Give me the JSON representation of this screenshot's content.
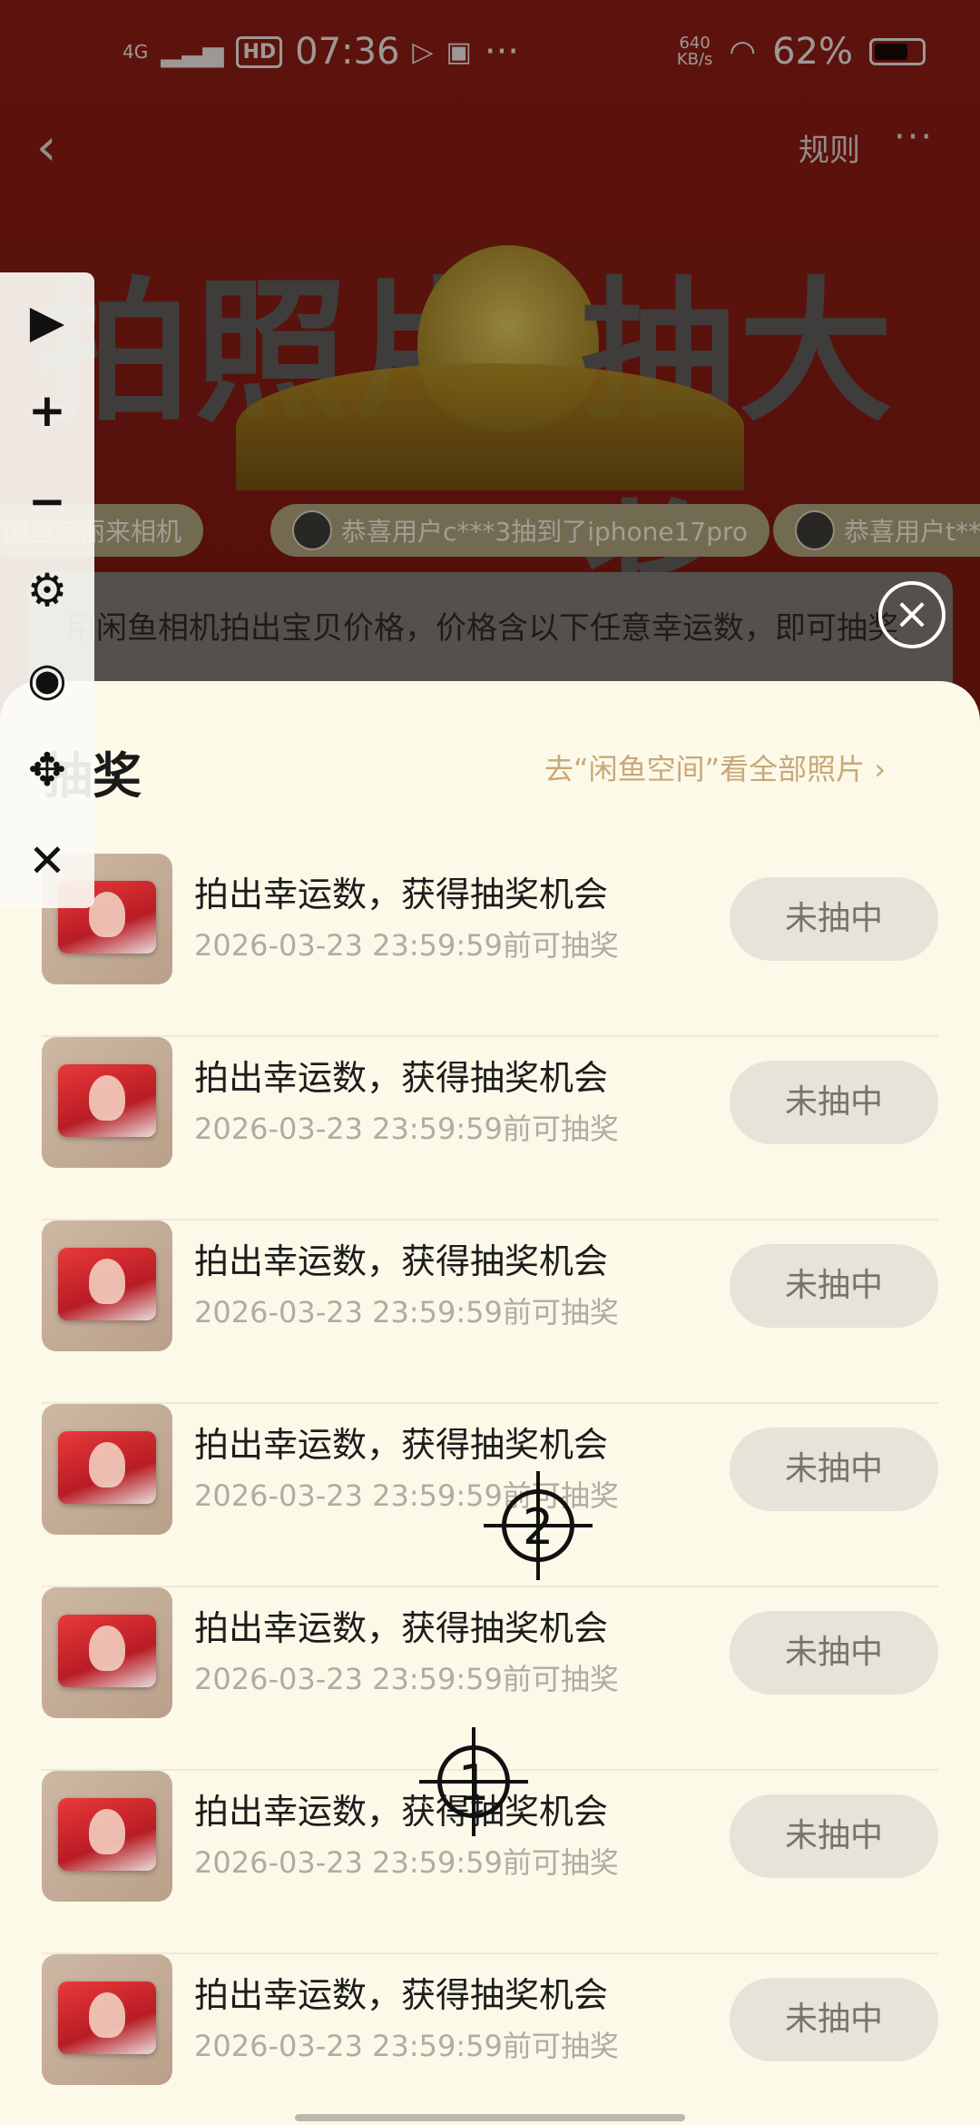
{
  "status": {
    "network": "4G",
    "hd": "HD",
    "time": "07:36",
    "more": "···",
    "speed_value": "640",
    "speed_unit": "KB/s",
    "battery": "62%"
  },
  "nav": {
    "back": "‹",
    "rules": "规则",
    "more": "···"
  },
  "hero": {
    "left": "拍照片",
    "right": "抽大奖"
  },
  "ticker": [
    "闲鱼宝丽来相机",
    "恭喜用户c***3抽到了iphone17pro",
    "恭喜用户t***"
  ],
  "info": {
    "text": "用闲鱼相机拍出宝贝价格，价格含以下任意幸运数，即可抽奖"
  },
  "sheet": {
    "title": "抽奖",
    "link": "去“闲鱼空间”看全部照片 ›"
  },
  "rows": [
    {
      "title": "拍出幸运数，获得抽奖机会",
      "date": "2026-03-23 23:59:59前可抽奖",
      "button": "未抽中"
    },
    {
      "title": "拍出幸运数，获得抽奖机会",
      "date": "2026-03-23 23:59:59前可抽奖",
      "button": "未抽中"
    },
    {
      "title": "拍出幸运数，获得抽奖机会",
      "date": "2026-03-23 23:59:59前可抽奖",
      "button": "未抽中"
    },
    {
      "title": "拍出幸运数，获得抽奖机会",
      "date": "2026-03-23 23:59:59前可抽奖",
      "button": "未抽中"
    },
    {
      "title": "拍出幸运数，获得抽奖机会",
      "date": "2026-03-23 23:59:59前可抽奖",
      "button": "未抽中"
    },
    {
      "title": "拍出幸运数，获得抽奖机会",
      "date": "2026-03-23 23:59:59前可抽奖",
      "button": "未抽中"
    },
    {
      "title": "拍出幸运数，获得抽奖机会",
      "date": "2026-03-23 23:59:59前可抽奖",
      "button": "未抽中"
    }
  ],
  "toolbar": {
    "icons": [
      "play-icon",
      "plus-icon",
      "minus-icon",
      "gear-icon",
      "eye-off-icon",
      "move-icon",
      "close-icon"
    ],
    "play": "▶",
    "plus": "+",
    "minus": "−",
    "gear": "⚙",
    "eye_off": "◉",
    "move": "✥",
    "close": "✕"
  },
  "markers": {
    "first": "1",
    "second": "2"
  },
  "close_symbol": "×",
  "colors": {
    "sheet_bg": "#fcf9e9",
    "link": "#c8a878",
    "button_bg": "#e6e3d8",
    "button_text": "#77736c",
    "header_red": "#8a1c14"
  }
}
